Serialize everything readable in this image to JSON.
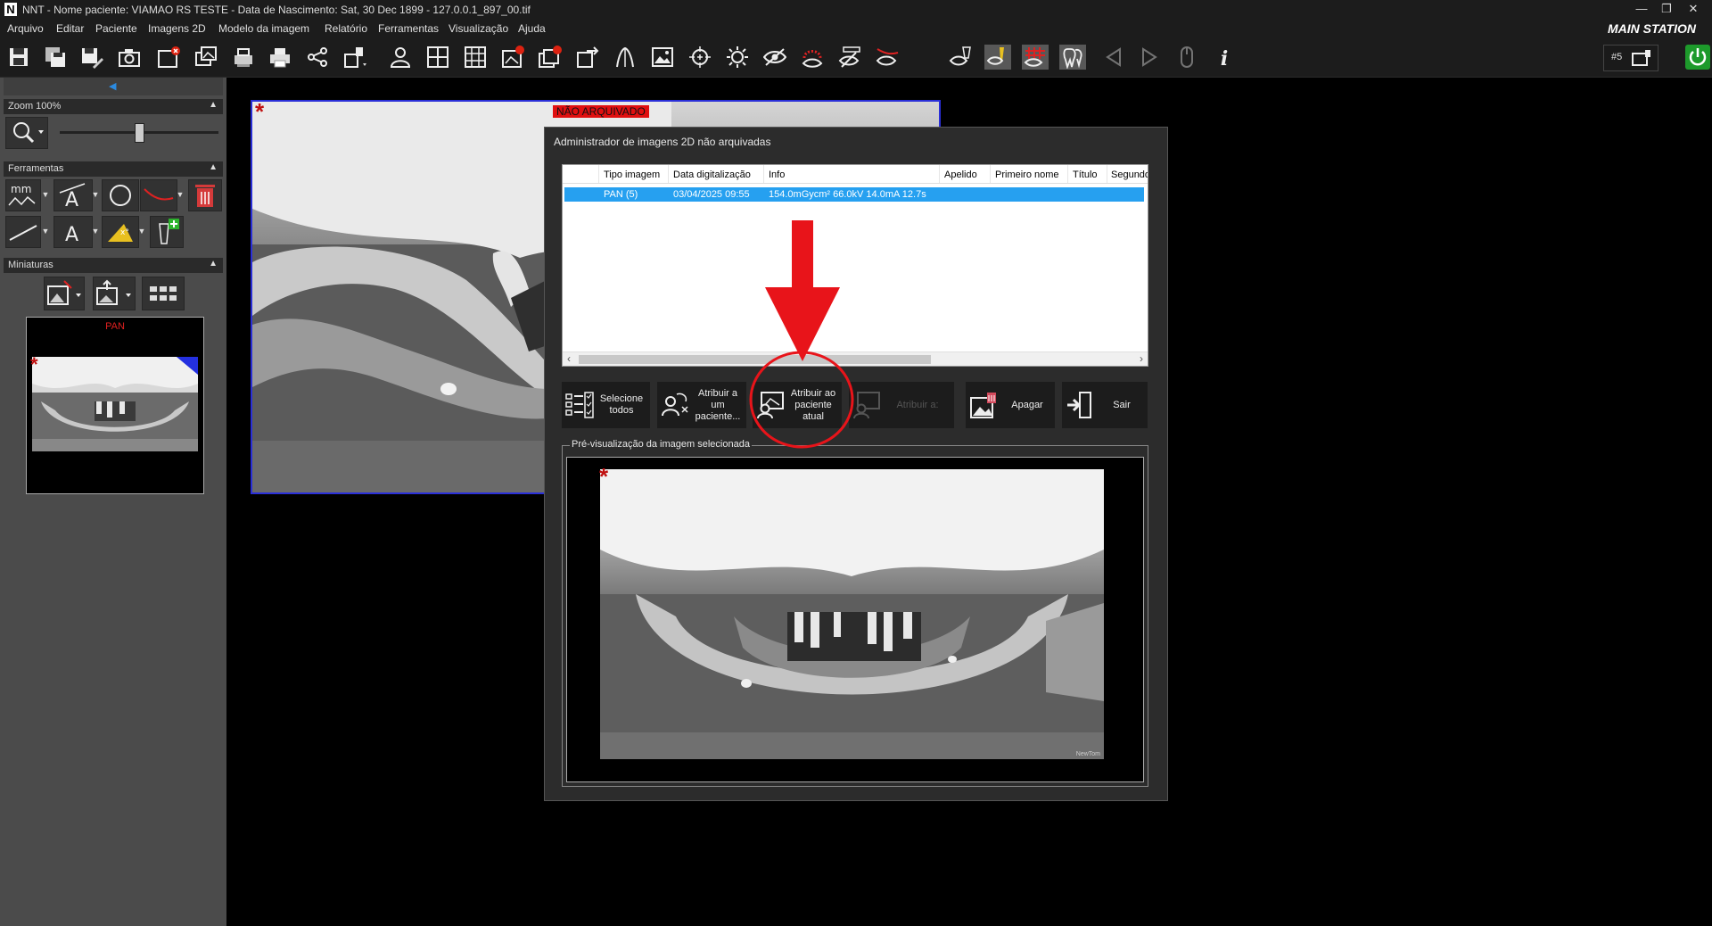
{
  "window": {
    "title": "NNT - Nome paciente: VIAMAO RS TESTE - Data de Nascimento: Sat, 30 Dec 1899 - 127.0.0.1_897_00.tif",
    "app_logo": "N",
    "station": "MAIN STATION"
  },
  "menu": [
    "Arquivo",
    "Editar",
    "Paciente",
    "Imagens 2D",
    "Modelo da imagem",
    "Relatório",
    "Ferramentas",
    "Visualização",
    "Ajuda"
  ],
  "toolbar": {
    "icons": [
      "save-icon",
      "save-all-icon",
      "save-edit-icon",
      "camera-icon",
      "close-image-icon",
      "image-gallery-icon",
      "scanner-icon",
      "print-icon",
      "share-icon",
      "acquire-icon",
      "patient-icon",
      "layout-icon",
      "layout-grid-icon",
      "image-delete-icon",
      "images-delete-icon",
      "export-icon",
      "implant-icon",
      "image-icon",
      "magnify-icon",
      "brightness-icon",
      "eye-icon",
      "ruler-eye-icon",
      "eye-ruler-icon",
      "eye-curve-icon",
      "eye-implant-icon",
      "eye-pen-icon",
      "eye-grid-icon",
      "tooth-icon",
      "prev-icon",
      "next-icon",
      "mouse-icon",
      "info-icon"
    ],
    "station_number": "#5"
  },
  "left_panel": {
    "zoom_label": "Zoom 100%",
    "zoom_level": 0.5,
    "tools_label": "Ferramentas",
    "thumbnails_label": "Miniaturas",
    "thumbnail_title": "PAN"
  },
  "main_image": {
    "status": "NÃO ARQUIVADO"
  },
  "dialog": {
    "title": "Administrador de imagens 2D não arquivadas",
    "columns": [
      "Tipo imagem",
      "Data digitalização",
      "Info",
      "Apelido",
      "Primeiro nome",
      "Título",
      "Segundo n"
    ],
    "rows": [
      {
        "type": "PAN (5)",
        "date": "03/04/2025 09:55",
        "info": "154.0mGycm² 66.0kV 14.0mA 12.7s",
        "nickname": "",
        "first_name": "",
        "title": ""
      }
    ],
    "buttons": {
      "select_all": "Selecione todos",
      "assign_patient": "Atribuir a um paciente...",
      "assign_current": "Atribuir ao paciente atual",
      "assign_to": "Atribuir a:",
      "delete": "Apagar",
      "exit": "Sair"
    },
    "preview_label": "Pré-visualização da imagem selecionada",
    "preview_brand": "NewTom"
  },
  "colors": {
    "background": "#000000",
    "panel": "#4b4b4b",
    "selection": "#26a0f0",
    "annotation_red": "#e8141a",
    "power": "#1d9a2b"
  }
}
